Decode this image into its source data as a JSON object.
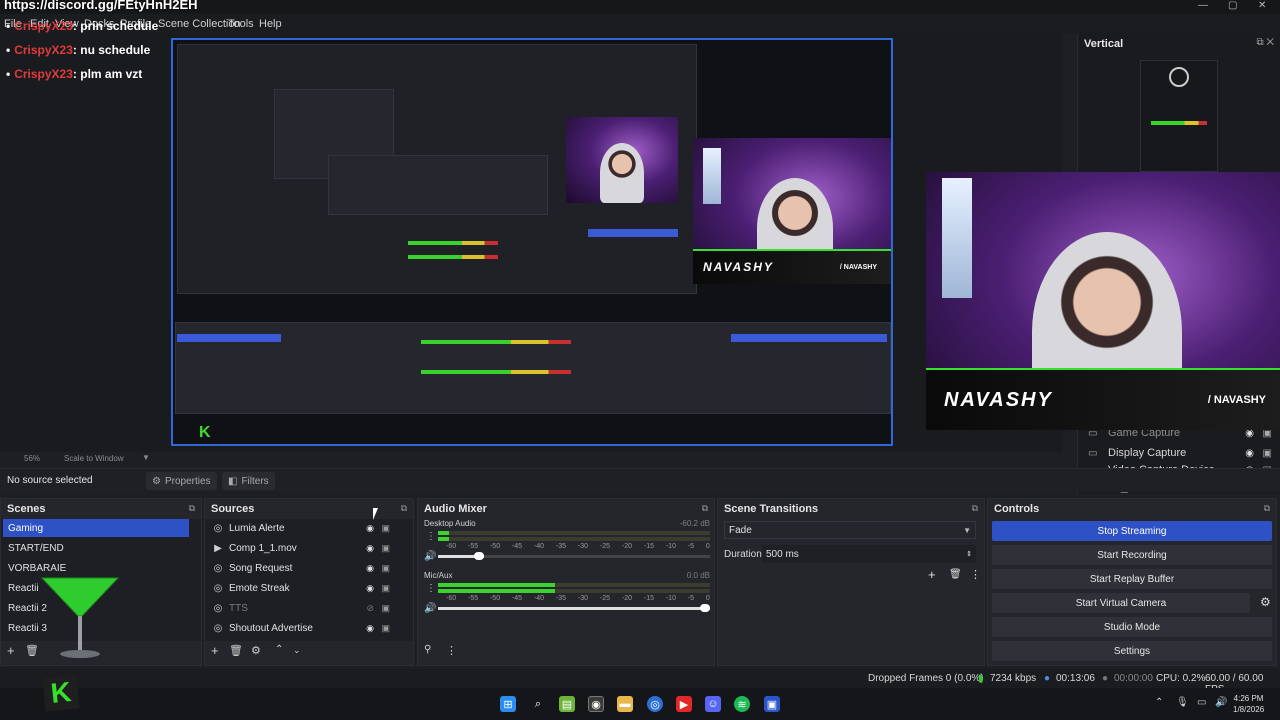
{
  "overlay": {
    "discord_url": "https://discord.gg/FEtyHnH2EH",
    "chat": [
      {
        "user": "CrispyX23",
        "message": ": prin schedule"
      },
      {
        "user": "CrispyX23",
        "message": ": nu schedule"
      },
      {
        "user": "CrispyX23",
        "message": ": plm am vzt"
      }
    ],
    "streamer_tag": "NAVASHY",
    "streamer_social": "/ NAVASHY"
  },
  "window": {
    "menu": [
      "File",
      "Edit",
      "View",
      "Docks",
      "Profile",
      "Scene Collection",
      "Tools",
      "Help"
    ],
    "controls": {
      "minimize": "—",
      "maximize": "▢",
      "close": "✕"
    }
  },
  "preview": {
    "zoom": "56%",
    "scale_mode": "Scale to Window"
  },
  "vertical_dock": {
    "title": "Vertical",
    "sources": [
      {
        "name": "Game Capture",
        "icon": "monitor-icon"
      },
      {
        "name": "Display Capture",
        "icon": "monitor-icon"
      },
      {
        "name": "Video Capture Device",
        "icon": "camera-icon"
      }
    ]
  },
  "source_bar": {
    "no_source": "No source selected",
    "properties": "Properties",
    "filters": "Filters"
  },
  "scenes": {
    "title": "Scenes",
    "items": [
      "Gaming",
      "START/END",
      "VORBARAIE",
      "Reactii",
      "Reactii 2",
      "Reactii 3"
    ],
    "active_index": 0
  },
  "sources": {
    "title": "Sources",
    "items": [
      {
        "name": "Lumia Alerte",
        "icon": "globe-icon",
        "visible": true
      },
      {
        "name": "Comp 1_1.mov",
        "icon": "play-icon",
        "visible": true
      },
      {
        "name": "Song Request",
        "icon": "globe-icon",
        "visible": true
      },
      {
        "name": "Emote Streak",
        "icon": "globe-icon",
        "visible": true
      },
      {
        "name": "TTS",
        "icon": "globe-icon",
        "visible": false
      },
      {
        "name": "Shoutout Advertise",
        "icon": "globe-icon",
        "visible": true
      }
    ]
  },
  "audio_mixer": {
    "title": "Audio Mixer",
    "ticks": [
      "-60",
      "-55",
      "-50",
      "-45",
      "-40",
      "-35",
      "-30",
      "-25",
      "-20",
      "-15",
      "-10",
      "-5",
      "0"
    ],
    "channels": [
      {
        "name": "Desktop Audio",
        "db": "-60.2 dB",
        "level": 0.04,
        "volume": 0.17
      },
      {
        "name": "Mic/Aux",
        "db": "0.0 dB",
        "level": 0.43,
        "volume": 1.0
      }
    ]
  },
  "scene_transitions": {
    "title": "Scene Transitions",
    "transition": "Fade",
    "duration_label": "Duration",
    "duration_value": "500 ms"
  },
  "controls": {
    "title": "Controls",
    "buttons": [
      "Stop Streaming",
      "Start Recording",
      "Start Replay Buffer",
      "Start Virtual Camera",
      "Studio Mode",
      "Settings"
    ]
  },
  "status": {
    "dropped": "Dropped Frames 0 (0.0%)",
    "bitrate": "7234 kbps",
    "live_time": "00:13:06",
    "rec_time": "00:00:00",
    "cpu": "CPU: 0.2%",
    "fps": "60.00 / 60.00 FPS"
  },
  "taskbar": {
    "time": "4:26 PM",
    "date": "1/8/2026"
  },
  "colors": {
    "accent": "#2e51c5",
    "kick_green": "#37e02c",
    "chat_user": "#e03b3b"
  }
}
